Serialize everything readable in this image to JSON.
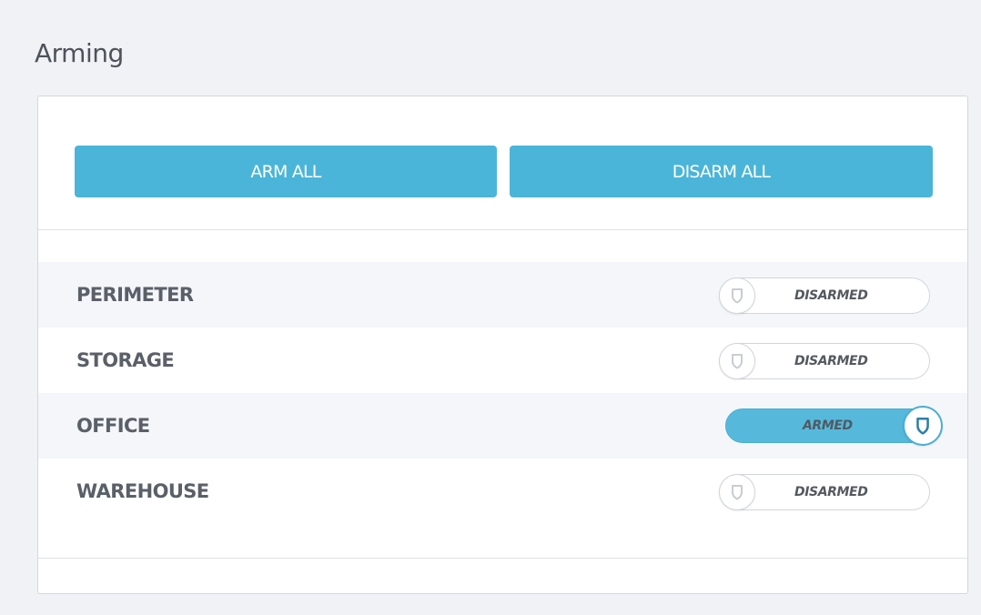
{
  "page": {
    "title": "Arming"
  },
  "actions": {
    "arm_all_label": "ARM ALL",
    "disarm_all_label": "DISARM ALL"
  },
  "zones": [
    {
      "name": "PERIMETER",
      "status": "DISARMED",
      "armed": false
    },
    {
      "name": "STORAGE",
      "status": "DISARMED",
      "armed": false
    },
    {
      "name": "OFFICE",
      "status": "ARMED",
      "armed": true
    },
    {
      "name": "WAREHOUSE",
      "status": "DISARMED",
      "armed": false
    }
  ],
  "icons": {
    "toggle_knob": "shield-icon"
  },
  "colors": {
    "accent": "#4ab5d8",
    "armed_track": "#56b9db",
    "shield_off": "#c9cdd2",
    "shield_on": "#2f7fa8"
  }
}
